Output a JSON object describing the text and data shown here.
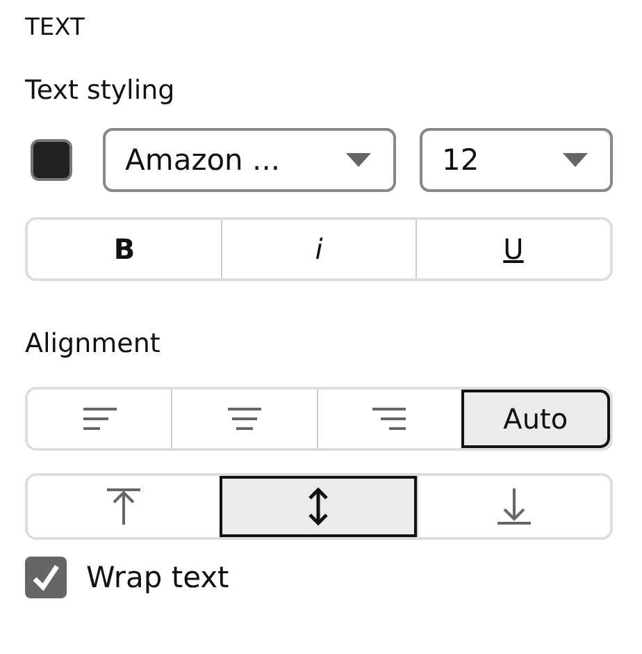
{
  "section_title": "TEXT",
  "text_styling": {
    "label": "Text styling",
    "color": "#222222",
    "font": {
      "value": "Amazon ..."
    },
    "size": {
      "value": "12"
    },
    "style_buttons": [
      {
        "kind": "bold",
        "label": "B",
        "selected": false
      },
      {
        "kind": "italic",
        "label": "i",
        "selected": false
      },
      {
        "kind": "underline",
        "label": "U",
        "selected": false
      }
    ]
  },
  "alignment": {
    "label": "Alignment",
    "horizontal": [
      {
        "kind": "left",
        "selected": false
      },
      {
        "kind": "center",
        "selected": false
      },
      {
        "kind": "right",
        "selected": false
      },
      {
        "kind": "auto",
        "label": "Auto",
        "selected": true
      }
    ],
    "vertical": [
      {
        "kind": "top",
        "selected": false
      },
      {
        "kind": "middle",
        "selected": true
      },
      {
        "kind": "bottom",
        "selected": false
      }
    ]
  },
  "wrap_text": {
    "label": "Wrap text",
    "checked": true
  }
}
